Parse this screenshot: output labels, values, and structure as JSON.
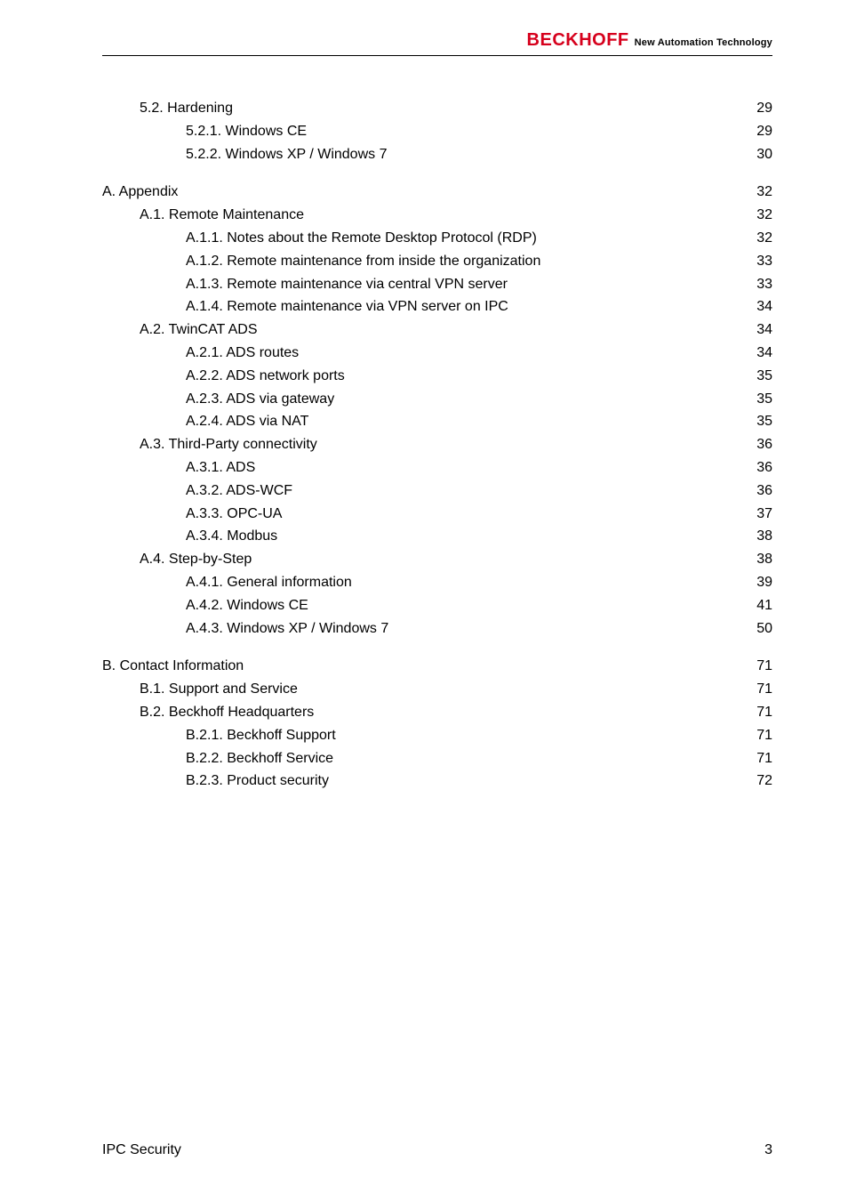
{
  "header": {
    "brand": "BECKHOFF",
    "tagline": "New Automation Technology"
  },
  "toc": {
    "blocks": [
      {
        "rows": [
          {
            "level": 1,
            "text": "5.2. Hardening",
            "page": "29"
          },
          {
            "level": 2,
            "text": "5.2.1. Windows CE",
            "page": "29"
          },
          {
            "level": 2,
            "text": "5.2.2. Windows XP / Windows 7",
            "page": "30"
          }
        ]
      },
      {
        "rows": [
          {
            "level": 0,
            "text": "A. Appendix",
            "page": "32",
            "nodots": true
          },
          {
            "level": 1,
            "text": "A.1. Remote Maintenance",
            "page": "32"
          },
          {
            "level": 2,
            "text": "A.1.1. Notes about the Remote Desktop Protocol (RDP)",
            "page": "32"
          },
          {
            "level": 2,
            "text": "A.1.2. Remote maintenance from inside the organization",
            "page": "33"
          },
          {
            "level": 2,
            "text": "A.1.3. Remote maintenance via central VPN server",
            "page": "33"
          },
          {
            "level": 2,
            "text": "A.1.4. Remote maintenance via VPN server on IPC",
            "page": "34"
          },
          {
            "level": 1,
            "text": "A.2. TwinCAT ADS",
            "page": "34"
          },
          {
            "level": 2,
            "text": "A.2.1. ADS routes",
            "page": "34"
          },
          {
            "level": 2,
            "text": "A.2.2. ADS network ports",
            "page": "35"
          },
          {
            "level": 2,
            "text": "A.2.3. ADS via gateway",
            "page": "35"
          },
          {
            "level": 2,
            "text": "A.2.4. ADS via NAT",
            "page": "35"
          },
          {
            "level": 1,
            "text": "A.3. Third-Party connectivity",
            "page": "36"
          },
          {
            "level": 2,
            "text": "A.3.1. ADS",
            "page": "36"
          },
          {
            "level": 2,
            "text": "A.3.2. ADS-WCF",
            "page": "36"
          },
          {
            "level": 2,
            "text": "A.3.3. OPC-UA",
            "page": "37"
          },
          {
            "level": 2,
            "text": "A.3.4. Modbus",
            "page": "38"
          },
          {
            "level": 1,
            "text": "A.4. Step-by-Step",
            "page": "38"
          },
          {
            "level": 2,
            "text": "A.4.1. General information",
            "page": "39"
          },
          {
            "level": 2,
            "text": "A.4.2. Windows CE",
            "page": "41"
          },
          {
            "level": 2,
            "text": "A.4.3. Windows XP / Windows 7",
            "page": "50"
          }
        ]
      },
      {
        "rows": [
          {
            "level": 0,
            "text": "B. Contact Information",
            "page": "71",
            "nodots": true
          },
          {
            "level": 1,
            "text": "B.1. Support and Service",
            "page": "71"
          },
          {
            "level": 1,
            "text": "B.2. Beckhoff Headquarters",
            "page": "71"
          },
          {
            "level": 2,
            "text": "B.2.1. Beckhoff Support",
            "page": "71"
          },
          {
            "level": 2,
            "text": "B.2.2. Beckhoff Service",
            "page": "71"
          },
          {
            "level": 2,
            "text": "B.2.3. Product security",
            "page": "72"
          }
        ]
      }
    ]
  },
  "footer": {
    "left": "IPC Security",
    "right": "3"
  }
}
